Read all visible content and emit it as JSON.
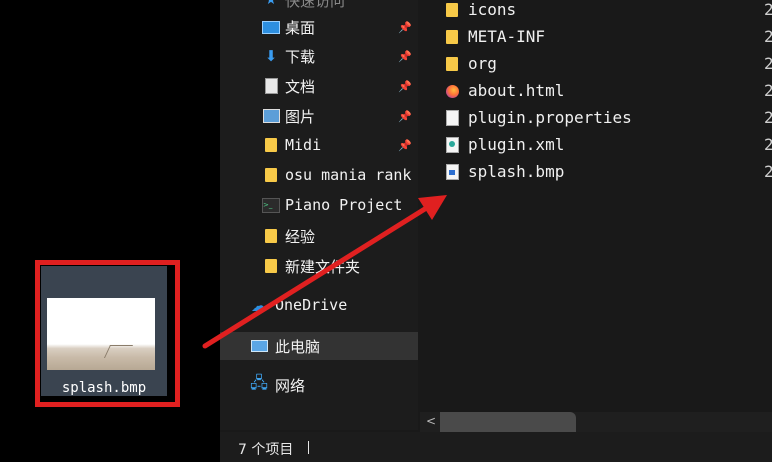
{
  "desktop": {
    "file_label": "splash.bmp"
  },
  "sidebar": {
    "header_partial": "快速访问",
    "items": [
      {
        "label": "桌面",
        "icon": "desktop-icon",
        "pinned": true
      },
      {
        "label": "下载",
        "icon": "download-icon",
        "pinned": true
      },
      {
        "label": "文档",
        "icon": "document-icon",
        "pinned": true
      },
      {
        "label": "图片",
        "icon": "picture-icon",
        "pinned": true
      },
      {
        "label": "Midi",
        "icon": "folder-icon",
        "pinned": true
      },
      {
        "label": "osu mania rank",
        "icon": "folder-icon",
        "pinned": false
      },
      {
        "label": "Piano Project",
        "icon": "terminal-icon",
        "pinned": false
      },
      {
        "label": "经验",
        "icon": "folder-icon",
        "pinned": false
      },
      {
        "label": "新建文件夹",
        "icon": "folder-icon",
        "pinned": false
      }
    ],
    "roots": [
      {
        "label": "OneDrive",
        "icon": "cloud-icon"
      },
      {
        "label": "此电脑",
        "icon": "computer-icon"
      },
      {
        "label": "网络",
        "icon": "network-icon"
      }
    ],
    "pin_glyph": "📌"
  },
  "files": [
    {
      "name": "icons",
      "icon": "folder-icon",
      "date_partial": "2"
    },
    {
      "name": "META-INF",
      "icon": "folder-icon",
      "date_partial": "2"
    },
    {
      "name": "org",
      "icon": "folder-icon",
      "date_partial": "2"
    },
    {
      "name": "about.html",
      "icon": "firefox-icon",
      "date_partial": "2"
    },
    {
      "name": "plugin.properties",
      "icon": "file-icon",
      "date_partial": "2"
    },
    {
      "name": "plugin.xml",
      "icon": "xml-file-icon",
      "date_partial": "2"
    },
    {
      "name": "splash.bmp",
      "icon": "bmp-file-icon",
      "date_partial": "2"
    }
  ],
  "statusbar": {
    "item_count": "7 个项目"
  },
  "colors": {
    "highlight": "#e02020",
    "folder": "#f7c948",
    "accent": "#2d8fe0"
  }
}
